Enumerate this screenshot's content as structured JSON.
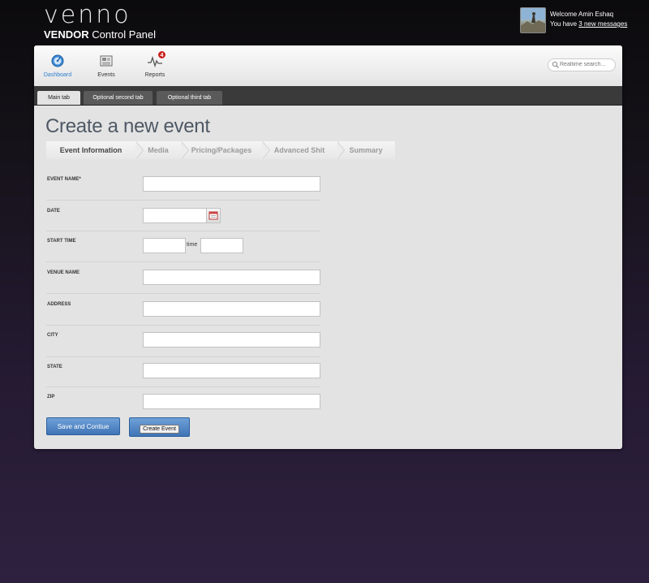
{
  "brand": {
    "logo": "venno",
    "sub_bold": "VENDOR",
    "sub_rest": "Control Panel"
  },
  "user": {
    "welcome": "Welcome Amin Eshaq",
    "messages_prefix": "You have ",
    "messages_link": "3 new messages"
  },
  "nav": [
    {
      "label": "Dashboard",
      "icon": "dashboard-icon",
      "active": true
    },
    {
      "label": "Events",
      "icon": "events-icon"
    },
    {
      "label": "Reports",
      "icon": "reports-icon",
      "badge": "4"
    }
  ],
  "search": {
    "placeholder": "Realtime search..."
  },
  "tabs": [
    {
      "label": "Main tab",
      "active": true
    },
    {
      "label": "Optional second tab"
    },
    {
      "label": "Optional third tab"
    }
  ],
  "page": {
    "title": "Create a new event"
  },
  "steps": [
    {
      "label": "Event Information",
      "active": true
    },
    {
      "label": "Media"
    },
    {
      "label": "Pricing/Packages"
    },
    {
      "label": "Advanced Shit"
    },
    {
      "label": "Summary"
    }
  ],
  "form": {
    "event_name": {
      "label": "EVENT NAME*",
      "value": ""
    },
    "date": {
      "label": "DATE",
      "value": ""
    },
    "start_time": {
      "label": "START TIME",
      "separator": "time",
      "value_1": "",
      "value_2": ""
    },
    "venue_name": {
      "label": "VENUE NAME",
      "value": ""
    },
    "address": {
      "label": "ADDRESS",
      "value": ""
    },
    "city": {
      "label": "CITY",
      "value": ""
    },
    "state": {
      "label": "STATE",
      "value": ""
    },
    "zip": {
      "label": "ZIP",
      "value": ""
    }
  },
  "buttons": {
    "save": "Save and Contiue",
    "create": "Create Event"
  },
  "colors": {
    "accent": "#2f7fd0",
    "button": "#4a80c2",
    "badge": "#c8201c",
    "title": "#4f5965"
  }
}
